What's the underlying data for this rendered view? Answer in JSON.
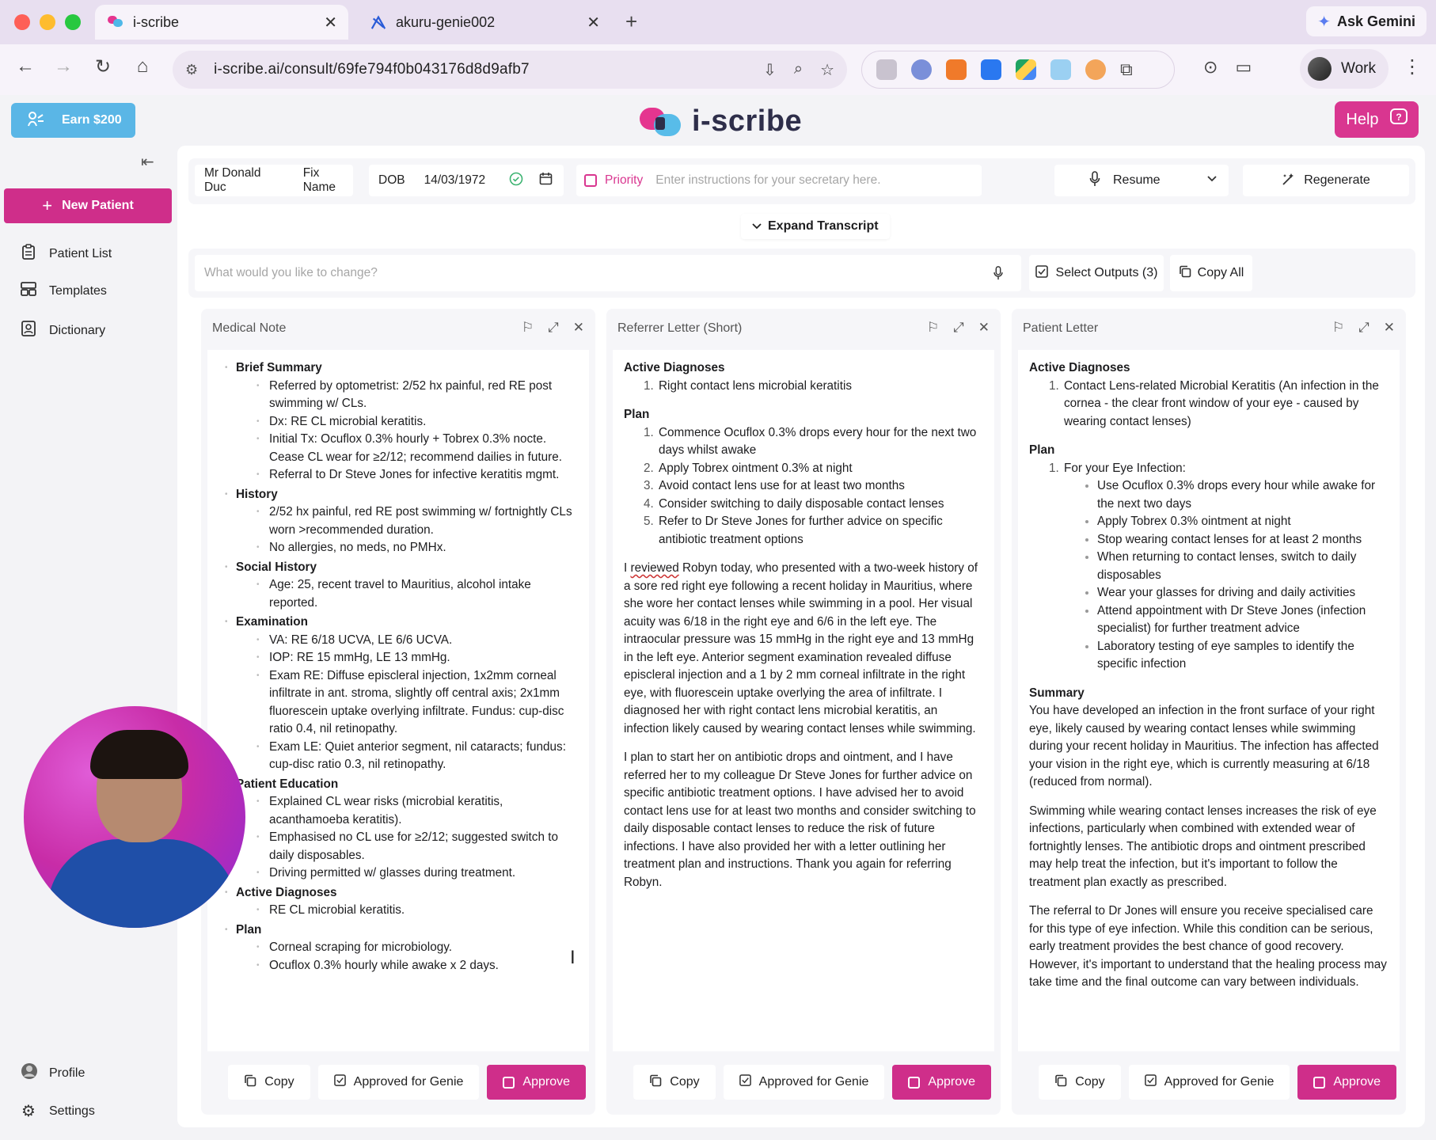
{
  "browser": {
    "tabs": [
      {
        "title": "i-scribe",
        "active": true
      },
      {
        "title": "akuru-genie002",
        "active": false
      }
    ],
    "url": "i-scribe.ai/consult/69fe794f0b043176d8d9afb7",
    "gemini_label": "Ask Gemini",
    "profile_label": "Work"
  },
  "header": {
    "earn_label": "Earn $200",
    "logo_text": "i-scribe",
    "help_label": "Help"
  },
  "sidebar": {
    "new_patient_label": "New Patient",
    "items": [
      {
        "label": "Patient List",
        "icon": "clipboard-icon"
      },
      {
        "label": "Templates",
        "icon": "templates-icon"
      },
      {
        "label": "Dictionary",
        "icon": "dictionary-icon"
      }
    ],
    "profile_label": "Profile",
    "settings_label": "Settings"
  },
  "consult": {
    "patient_name": "Mr Donald Duc",
    "fix_name_label": "Fix Name",
    "dob_label": "DOB",
    "dob_value": "14/03/1972",
    "priority_label": "Priority",
    "secretary_placeholder": "Enter instructions for your secretary here.",
    "resume_label": "Resume",
    "regenerate_label": "Regenerate",
    "expand_transcript_label": "Expand Transcript",
    "change_placeholder": "What would you like to change?",
    "select_outputs_label": "Select Outputs (3)",
    "copy_all_label": "Copy All"
  },
  "footer_labels": {
    "copy": "Copy",
    "approved_for_genie": "Approved for Genie",
    "approve": "Approve"
  },
  "medical_note": {
    "title": "Medical Note",
    "sections": [
      {
        "heading": "Brief Summary",
        "items": [
          "Referred by optometrist: 2/52 hx painful, red RE post swimming w/ CLs.",
          "Dx: RE CL microbial keratitis.",
          "Initial Tx: Ocuflox 0.3% hourly + Tobrex 0.3% nocte. Cease CL wear for ≥2/12; recommend dailies in future.",
          "Referral to Dr Steve Jones for infective keratitis mgmt."
        ]
      },
      {
        "heading": "History",
        "items": [
          "2/52 hx painful, red RE post swimming w/ fortnightly CLs worn >recommended duration.",
          "No allergies, no meds, no PMHx."
        ]
      },
      {
        "heading": "Social History",
        "items": [
          "Age: 25, recent travel to Mauritius, alcohol intake reported."
        ]
      },
      {
        "heading": "Examination",
        "items": [
          "VA: RE 6/18 UCVA, LE 6/6 UCVA.",
          "IOP: RE 15 mmHg, LE 13 mmHg.",
          "Exam RE: Diffuse episcleral injection, 1x2mm corneal infiltrate in ant. stroma, slightly off central axis; 2x1mm fluorescein uptake overlying infiltrate. Fundus: cup-disc ratio 0.4, nil retinopathy.",
          "Exam LE: Quiet anterior segment, nil cataracts; fundus: cup-disc ratio 0.3, nil retinopathy."
        ]
      },
      {
        "heading": "Patient Education",
        "items": [
          "Explained CL wear risks (microbial keratitis, acanthamoeba keratitis).",
          "Emphasised no CL use for ≥2/12; suggested switch to daily disposables.",
          "Driving permitted w/ glasses during treatment."
        ]
      },
      {
        "heading": "Active Diagnoses",
        "items": [
          "RE CL microbial keratitis."
        ]
      },
      {
        "heading": "Plan",
        "items": [
          "Corneal scraping for microbiology.",
          "Ocuflox 0.3% hourly while awake x 2 days."
        ]
      }
    ]
  },
  "referrer_letter": {
    "title": "Referrer Letter (Short)",
    "diagnoses_heading": "Active Diagnoses",
    "diagnoses": [
      "Right contact lens microbial keratitis"
    ],
    "plan_heading": "Plan",
    "plan": [
      "Commence Ocuflox 0.3% drops every hour for the next two days whilst awake",
      "Apply Tobrex ointment 0.3% at night",
      "Avoid contact lens use for at least two months",
      "Consider switching to daily disposable contact lenses",
      "Refer to Dr Steve Jones for further advice on specific antibiotic treatment options"
    ],
    "para1_lead": "I",
    "para1_underlined": "reviewed",
    "para1_rest": " Robyn today, who presented with a two-week history of a sore red right eye following a recent holiday in Mauritius, where she wore her contact lenses while swimming in a pool. Her visual acuity was 6/18 in the right eye and 6/6 in the left eye. The intraocular pressure was 15 mmHg in the right eye and 13 mmHg in the left eye. Anterior segment examination revealed diffuse episcleral injection and a 1 by 2 mm corneal infiltrate in the right eye, with fluorescein uptake overlying the area of infiltrate. I diagnosed her with right contact lens microbial keratitis, an infection likely caused by wearing contact lenses while swimming.",
    "para2": "I plan to start her on antibiotic drops and ointment, and I have referred her to my colleague Dr Steve Jones for further advice on specific antibiotic treatment options. I have advised her to avoid contact lens use for at least two months and consider switching to daily disposable contact lenses to reduce the risk of future infections. I have also provided her with a letter outlining her treatment plan and instructions. Thank you again for referring Robyn."
  },
  "patient_letter": {
    "title": "Patient Letter",
    "diagnoses_heading": "Active Diagnoses",
    "diagnoses": [
      "Contact Lens-related Microbial Keratitis (An infection in the cornea - the clear front window of your eye - caused by wearing contact lenses)"
    ],
    "plan_heading": "Plan",
    "plan_item": "For your Eye Infection:",
    "plan_subitems": [
      "Use Ocuflox 0.3% drops every hour while awake for the next two days",
      "Apply Tobrex 0.3% ointment at night",
      "Stop wearing contact lenses for at least 2 months",
      "When returning to contact lenses, switch to daily disposables",
      "Wear your glasses for driving and daily activities",
      "Attend appointment with Dr Steve Jones (infection specialist) for further treatment advice",
      "Laboratory testing of eye samples to identify the specific infection"
    ],
    "summary_heading": "Summary",
    "summary_paras": [
      "You have developed an infection in the front surface of your right eye, likely caused by wearing contact lenses while swimming during your recent holiday in Mauritius. The infection has affected your vision in the right eye, which is currently measuring at 6/18 (reduced from normal).",
      "Swimming while wearing contact lenses increases the risk of eye infections, particularly when combined with extended wear of fortnightly lenses. The antibiotic drops and ointment prescribed may help treat the infection, but it's important to follow the treatment plan exactly as prescribed.",
      "The referral to Dr Jones will ensure you receive specialised care for this type of eye infection. While this condition can be serious, early treatment provides the best chance of good recovery. However, it's important to understand that the healing process may take time and the final outcome can vary between individuals."
    ]
  },
  "colors": {
    "brand_pink": "#cf2e8a",
    "brand_blue": "#5ab6e6"
  }
}
